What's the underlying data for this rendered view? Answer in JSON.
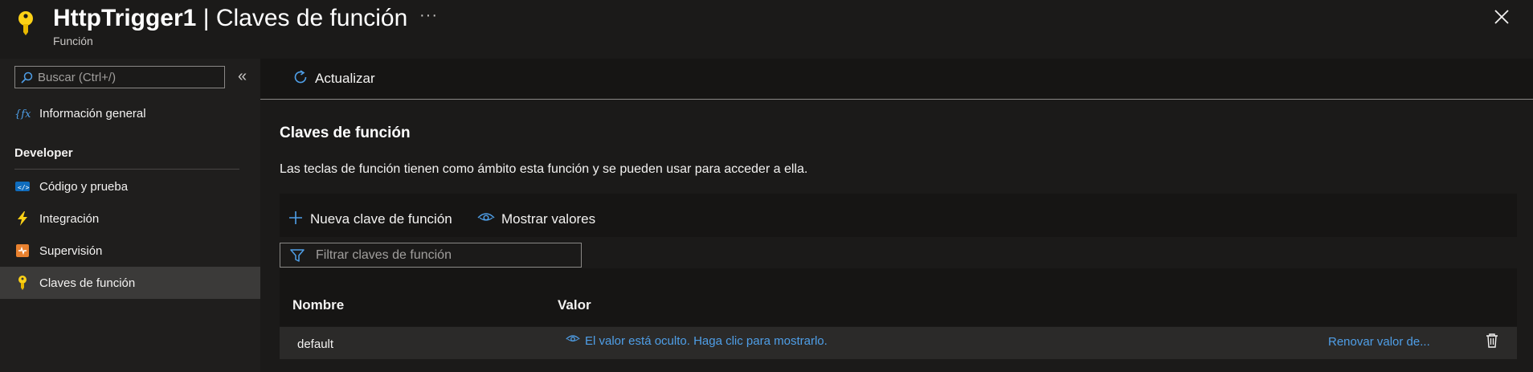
{
  "header": {
    "title_main": "HttpTrigger1",
    "title_rest": " | Claves de función",
    "subtitle": "Función",
    "more": "···",
    "icon": "key-icon",
    "accent": "#fcd116"
  },
  "sidebar": {
    "search_placeholder": "Buscar (Ctrl+/)",
    "collapse": "«",
    "overview_label": "Información general",
    "section_developer": "Developer",
    "items": [
      {
        "label": "Código y prueba",
        "icon": "code-icon"
      },
      {
        "label": "Integración",
        "icon": "lightning-icon"
      },
      {
        "label": "Supervisión",
        "icon": "monitor-icon"
      },
      {
        "label": "Claves de función",
        "icon": "key-icon",
        "selected": true
      }
    ]
  },
  "toolbar": {
    "refresh_label": "Actualizar"
  },
  "main": {
    "title": "Claves de función",
    "description": "Las teclas de función tienen como ámbito esta función y se pueden usar para acceder a ella.",
    "new_key_label": "Nueva clave de función",
    "show_values_label": "Mostrar valores",
    "filter_placeholder": "Filtrar claves de función",
    "table": {
      "headers": [
        "Nombre",
        "Valor"
      ],
      "rows": [
        {
          "name": "default",
          "value": "El valor está oculto. Haga clic para mostrarlo.",
          "action": "Renovar valor de..."
        }
      ]
    }
  },
  "colors": {
    "link": "#4f9fe8",
    "background": "#1b1a19"
  }
}
